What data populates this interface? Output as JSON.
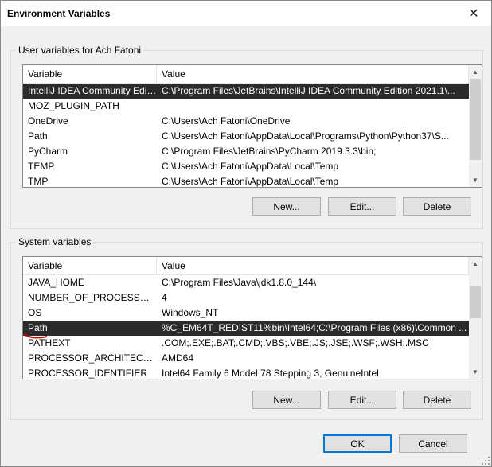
{
  "window": {
    "title": "Environment Variables",
    "close_glyph": "✕"
  },
  "user_vars": {
    "label": "User variables for Ach Fatoni",
    "columns": [
      "Variable",
      "Value"
    ],
    "rows": [
      {
        "name": "IntelliJ IDEA Community Editi...",
        "value": "C:\\Program Files\\JetBrains\\IntelliJ IDEA Community Edition 2021.1\\...",
        "selected": true
      },
      {
        "name": "MOZ_PLUGIN_PATH",
        "value": ""
      },
      {
        "name": "OneDrive",
        "value": "C:\\Users\\Ach Fatoni\\OneDrive"
      },
      {
        "name": "Path",
        "value": "C:\\Users\\Ach Fatoni\\AppData\\Local\\Programs\\Python\\Python37\\S..."
      },
      {
        "name": "PyCharm",
        "value": "C:\\Program Files\\JetBrains\\PyCharm 2019.3.3\\bin;"
      },
      {
        "name": "TEMP",
        "value": "C:\\Users\\Ach Fatoni\\AppData\\Local\\Temp"
      },
      {
        "name": "TMP",
        "value": "C:\\Users\\Ach Fatoni\\AppData\\Local\\Temp"
      }
    ],
    "buttons": {
      "new": "New...",
      "edit": "Edit...",
      "delete": "Delete"
    }
  },
  "system_vars": {
    "label": "System variables",
    "columns": [
      "Variable",
      "Value"
    ],
    "rows": [
      {
        "name": "JAVA_HOME",
        "value": "C:\\Program Files\\Java\\jdk1.8.0_144\\"
      },
      {
        "name": "NUMBER_OF_PROCESSORS",
        "value": "4"
      },
      {
        "name": "OS",
        "value": "Windows_NT"
      },
      {
        "name": "Path",
        "value": "%C_EM64T_REDIST11%bin\\Intel64;C:\\Program Files (x86)\\Common ...",
        "selected": true
      },
      {
        "name": "PATHEXT",
        "value": ".COM;.EXE;.BAT;.CMD;.VBS;.VBE;.JS;.JSE;.WSF;.WSH;.MSC"
      },
      {
        "name": "PROCESSOR_ARCHITECTURE",
        "value": "AMD64"
      },
      {
        "name": "PROCESSOR_IDENTIFIER",
        "value": "Intel64 Family 6 Model 78 Stepping 3, GenuineIntel"
      }
    ],
    "buttons": {
      "new": "New...",
      "edit": "Edit...",
      "delete": "Delete"
    }
  },
  "footer": {
    "ok": "OK",
    "cancel": "Cancel"
  },
  "colors": {
    "selected_bg": "#2b2b2b",
    "default_border": "#0078d7",
    "annotation": "#d00000"
  }
}
